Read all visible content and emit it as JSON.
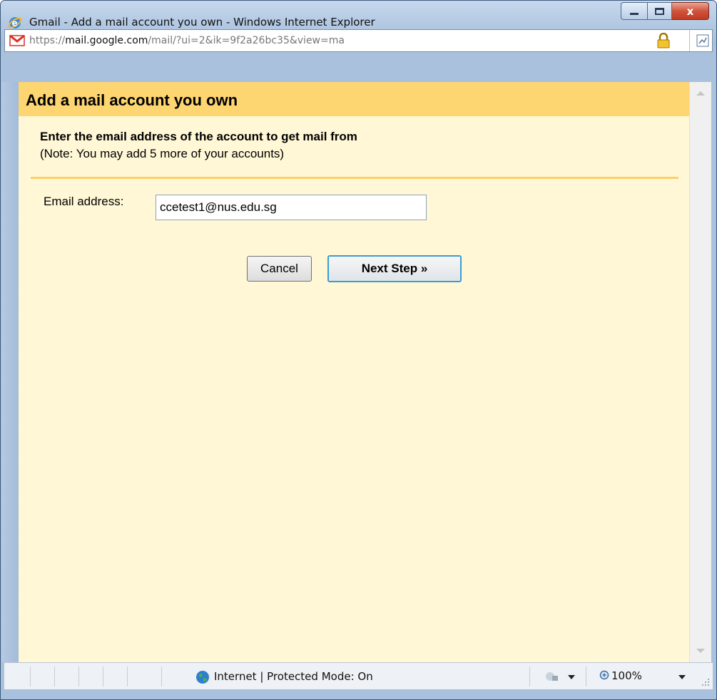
{
  "window": {
    "title": "Gmail - Add a mail account you own - Windows Internet Explorer",
    "close_glyph": "x"
  },
  "addressbar": {
    "url_prefix": "https://",
    "url_domain": "mail.google.com",
    "url_path": "/mail/?ui=2&ik=9f2a26bc35&view=ma"
  },
  "dialog": {
    "title": "Add a mail account you own",
    "instruction": "Enter the email address of the account to get mail from",
    "note": "(Note: You may add 5 more of your accounts)",
    "email_label": "Email address:",
    "email_value": "ccetest1@nus.edu.sg",
    "cancel_label": "Cancel",
    "next_label": "Next Step »"
  },
  "statusbar": {
    "zone": "Internet | Protected Mode: On",
    "zoom": "100%"
  },
  "colors": {
    "header_bg": "#fdd571",
    "content_bg": "#fff7d6",
    "divider": "#fcd06b",
    "next_border": "#3d9ccf"
  },
  "icons": [
    "ie-icon",
    "gmail-icon",
    "lock-icon",
    "rss-icon",
    "globe-icon",
    "security-icon",
    "zoom-icon"
  ]
}
